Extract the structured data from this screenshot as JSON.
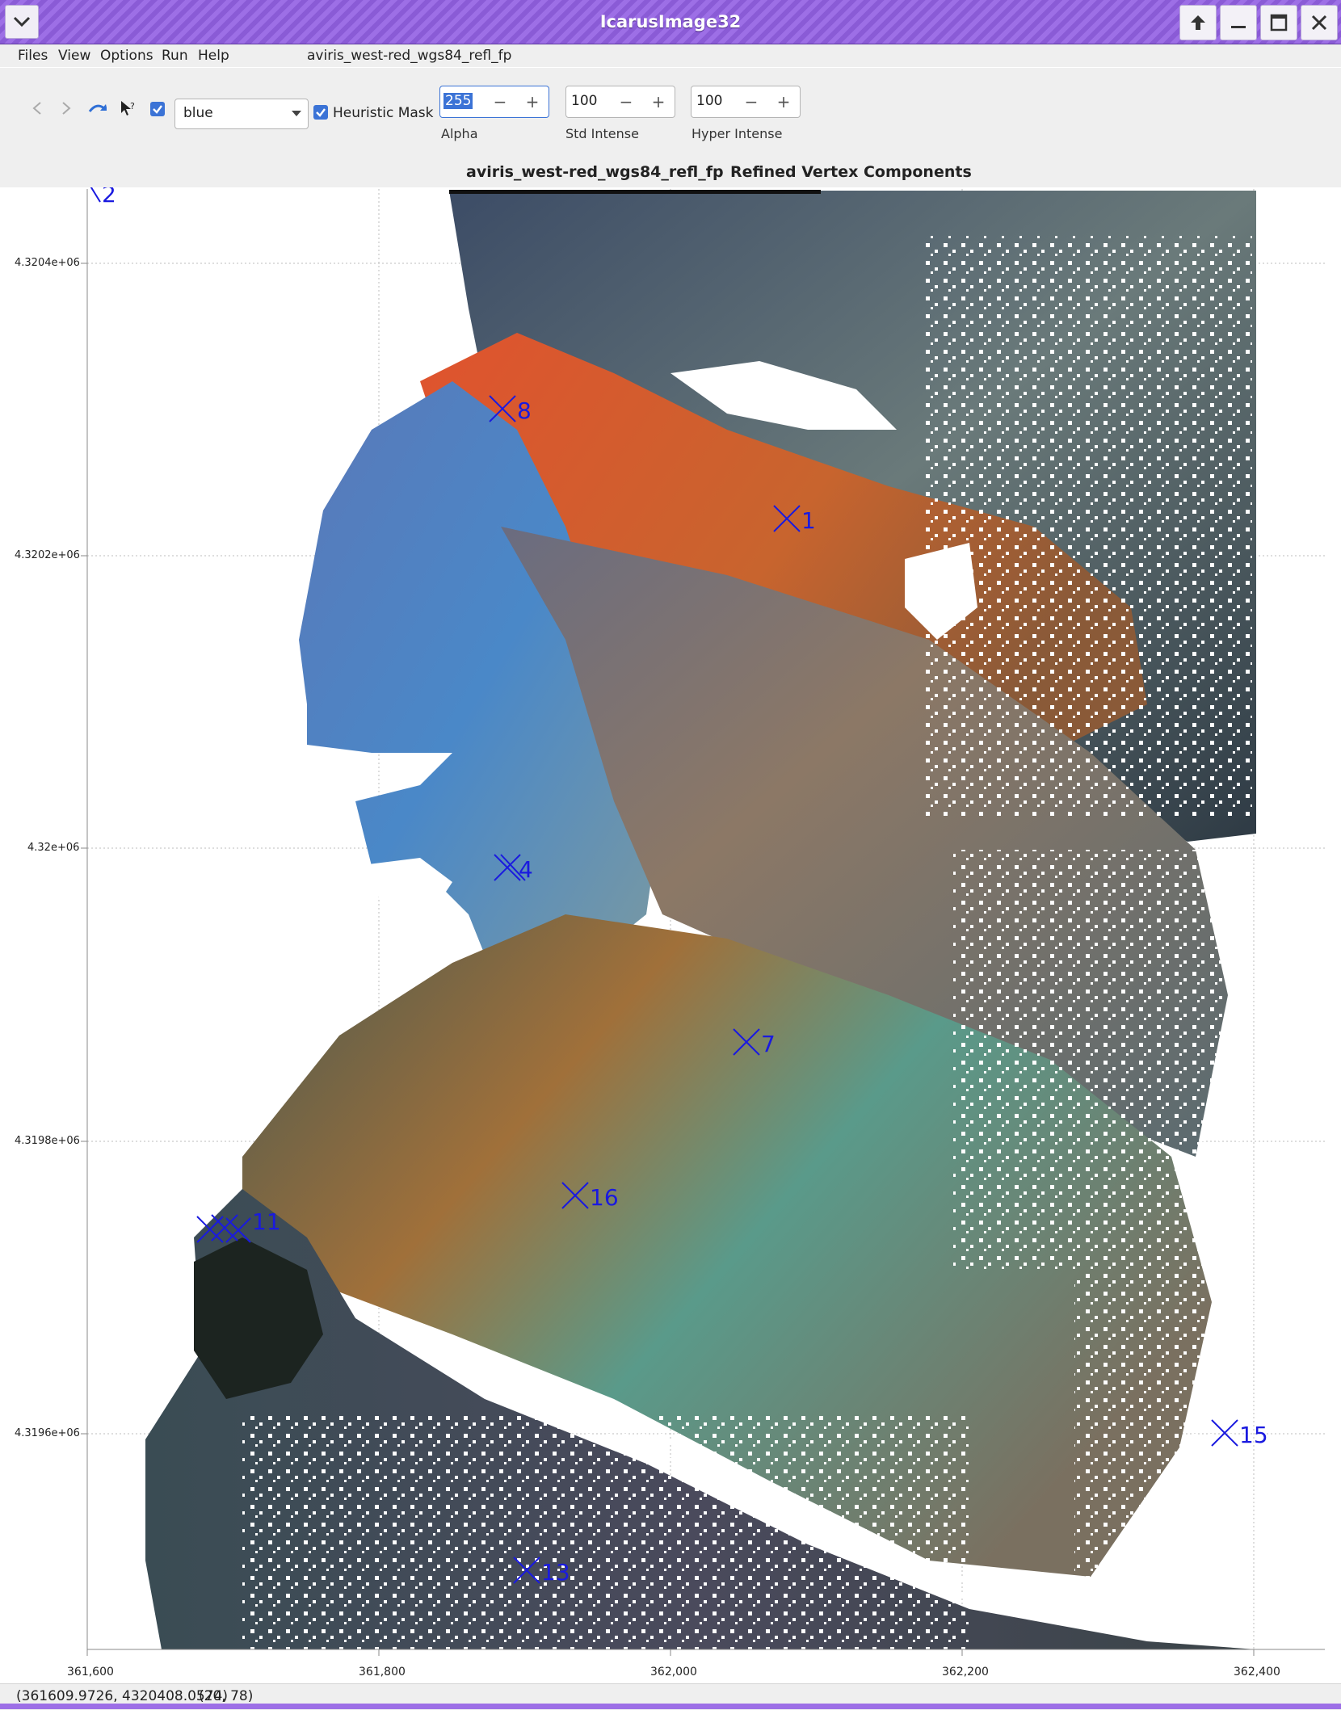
{
  "window": {
    "title": "IcarusImage32",
    "menu_icon": "chevron-down-icon",
    "buttons": [
      "up-arrow-icon",
      "minimize-icon",
      "maximize-icon",
      "close-icon"
    ]
  },
  "menubar": {
    "items": [
      "Files",
      "View",
      "Options",
      "Run",
      "Help"
    ],
    "filename": "aviris_west-red_wgs84_refl_fp"
  },
  "toolbar": {
    "icons": [
      "back-arrow-icon",
      "forward-arrow-icon",
      "redo-icon",
      "pointer-help-icon"
    ],
    "band_checkbox_checked": true,
    "band_select_value": "blue",
    "heuristic_mask_checked": true,
    "heuristic_mask_label": "Heuristic Mask",
    "spinners": [
      {
        "value": "255",
        "label": "Alpha",
        "selected": true
      },
      {
        "value": "100",
        "label": "Std Intense",
        "selected": false
      },
      {
        "value": "100",
        "label": "Hyper Intense",
        "selected": false
      }
    ],
    "dec_symbol": "−",
    "inc_symbol": "+"
  },
  "tabs": {
    "items": [
      "aviris_west-red_wgs84_refl_fp",
      "Refined Vertex Components"
    ]
  },
  "plot": {
    "y_ticks": [
      "4.3204e+06",
      "4.3202e+06",
      "4.32e+06",
      "4.3198e+06",
      "4.3196e+06"
    ],
    "x_ticks": [
      "361,600",
      "361,800",
      "362,000",
      "362,200",
      "362,400"
    ],
    "markers": [
      {
        "label": "2"
      },
      {
        "label": "8"
      },
      {
        "label": "1"
      },
      {
        "label": "4"
      },
      {
        "label": "7"
      },
      {
        "label": "11"
      },
      {
        "label": "16"
      },
      {
        "label": "15"
      },
      {
        "label": "13"
      }
    ],
    "marker_color": "#1a1adf"
  },
  "status": {
    "coordinates": "(361609.9726, 4320408.0574)",
    "pixel": "(20, 78)"
  },
  "colors": {
    "titlebar": "#9d6fe6",
    "accent": "#3b73d6",
    "chrome": "#efefef"
  }
}
